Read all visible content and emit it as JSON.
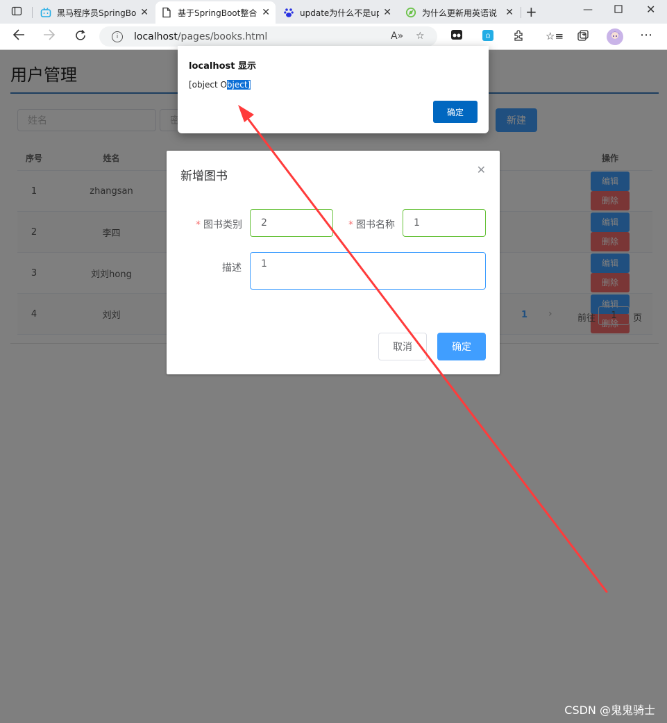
{
  "browser": {
    "tabs": [
      {
        "title": "黑马程序员SpringBo",
        "icon": "bilibili-icon"
      },
      {
        "title": "基于SpringBoot整合",
        "icon": "page-icon"
      },
      {
        "title": "update为什么不是up",
        "icon": "baidu-paw-icon"
      },
      {
        "title": "为什么更新用英语说",
        "icon": "search-leaf-icon"
      }
    ],
    "url_host": "localhost",
    "url_path": "/pages/books.html"
  },
  "page": {
    "title": "用户管理",
    "search_name_placeholder": "姓名",
    "search_second_placeholder": "密",
    "new_button": "新建",
    "table": {
      "headers": [
        "序号",
        "姓名",
        "操作"
      ],
      "rows": [
        {
          "no": "1",
          "name": "zhangsan"
        },
        {
          "no": "2",
          "name": "李四"
        },
        {
          "no": "3",
          "name": "刘刘hong"
        },
        {
          "no": "4",
          "name": "刘刘"
        }
      ],
      "edit_label": "编辑",
      "delete_label": "删除"
    },
    "pager": {
      "current": "1",
      "goto_label": "前往",
      "goto_value": "1",
      "page_label": "页"
    }
  },
  "dialog": {
    "title": "新增图书",
    "type_label": "图书类别",
    "type_value": "2",
    "name_label": "图书名称",
    "name_value": "1",
    "desc_label": "描述",
    "desc_value": "1",
    "cancel": "取消",
    "ok": "确定"
  },
  "alert": {
    "title": "localhost 显示",
    "message_plain": "[object O",
    "message_selected": "bject]",
    "ok": "确定"
  },
  "annotation": {
    "color": "#ff3b3b"
  },
  "watermark": "CSDN @鬼鬼骑士"
}
